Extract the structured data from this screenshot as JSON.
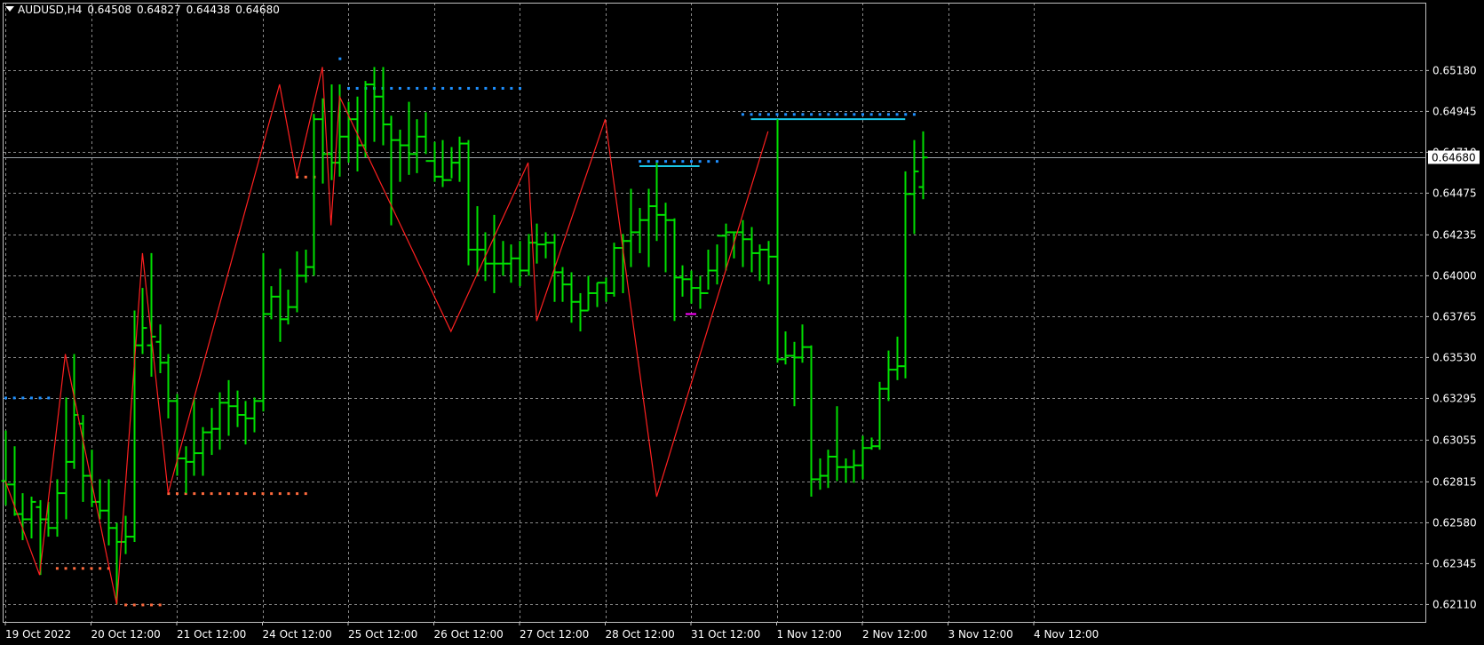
{
  "header": {
    "symbol": "AUDUSD,H4",
    "open": "0.64508",
    "high": "0.64827",
    "low": "0.64438",
    "close": "0.64680"
  },
  "price_tag": "0.64680",
  "colors": {
    "background": "#000000",
    "grid": "#8a8a8a",
    "axis": "#c0c0c0",
    "text": "#ffffff",
    "bars": "#00e000",
    "zigzag": "#ff2020",
    "resistance_dots": "#1e90ff",
    "support_dots": "#ff6a3d",
    "cyan_level": "#19c6e6",
    "magenta_mark": "#ff00ff"
  },
  "chart_data": {
    "type": "ohlc",
    "symbol": "AUDUSD",
    "timeframe": "H4",
    "grid": true,
    "ylim": [
      0.6201,
      0.6557
    ],
    "y_ticks": [
      "0.65180",
      "0.64945",
      "0.64710",
      "0.64475",
      "0.64235",
      "0.64000",
      "0.63765",
      "0.63530",
      "0.63295",
      "0.63055",
      "0.62815",
      "0.62580",
      "0.62345",
      "0.62110"
    ],
    "x_labels": [
      "19 Oct 2022",
      "20 Oct 12:00",
      "21 Oct 12:00",
      "24 Oct 12:00",
      "25 Oct 12:00",
      "26 Oct 12:00",
      "27 Oct 12:00",
      "28 Oct 12:00",
      "31 Oct 12:00",
      "1 Nov 12:00",
      "2 Nov 12:00",
      "3 Nov 12:00",
      "4 Nov 12:00"
    ],
    "current_price": 0.6468,
    "bars": [
      {
        "i": 0,
        "o": 0.6282,
        "h": 0.6311,
        "l": 0.6268,
        "c": 0.628
      },
      {
        "i": 1,
        "o": 0.628,
        "h": 0.6302,
        "l": 0.6262,
        "c": 0.6263
      },
      {
        "i": 2,
        "o": 0.6263,
        "h": 0.6275,
        "l": 0.6248,
        "c": 0.626
      },
      {
        "i": 3,
        "o": 0.626,
        "h": 0.6273,
        "l": 0.6249,
        "c": 0.627
      },
      {
        "i": 4,
        "o": 0.6267,
        "h": 0.6271,
        "l": 0.6228,
        "c": 0.626
      },
      {
        "i": 5,
        "o": 0.626,
        "h": 0.627,
        "l": 0.625,
        "c": 0.6255
      },
      {
        "i": 6,
        "o": 0.6255,
        "h": 0.6283,
        "l": 0.625,
        "c": 0.6275
      },
      {
        "i": 7,
        "o": 0.6275,
        "h": 0.633,
        "l": 0.626,
        "c": 0.6293
      },
      {
        "i": 8,
        "o": 0.6293,
        "h": 0.6355,
        "l": 0.6289,
        "c": 0.632
      },
      {
        "i": 9,
        "o": 0.6315,
        "h": 0.632,
        "l": 0.627,
        "c": 0.6285
      },
      {
        "i": 10,
        "o": 0.6285,
        "h": 0.63,
        "l": 0.6267,
        "c": 0.627
      },
      {
        "i": 11,
        "o": 0.627,
        "h": 0.6283,
        "l": 0.626,
        "c": 0.6265
      },
      {
        "i": 12,
        "o": 0.6265,
        "h": 0.6283,
        "l": 0.6245,
        "c": 0.6255
      },
      {
        "i": 13,
        "o": 0.6255,
        "h": 0.6258,
        "l": 0.6211,
        "c": 0.6247
      },
      {
        "i": 14,
        "o": 0.6247,
        "h": 0.6262,
        "l": 0.624,
        "c": 0.625
      },
      {
        "i": 15,
        "o": 0.625,
        "h": 0.638,
        "l": 0.6247,
        "c": 0.636
      },
      {
        "i": 16,
        "o": 0.636,
        "h": 0.6393,
        "l": 0.6355,
        "c": 0.637
      },
      {
        "i": 17,
        "o": 0.636,
        "h": 0.6413,
        "l": 0.6342,
        "c": 0.6365
      },
      {
        "i": 18,
        "o": 0.6362,
        "h": 0.6372,
        "l": 0.6344,
        "c": 0.635
      },
      {
        "i": 19,
        "o": 0.635,
        "h": 0.6355,
        "l": 0.6318,
        "c": 0.6328
      },
      {
        "i": 20,
        "o": 0.6328,
        "h": 0.6332,
        "l": 0.6285,
        "c": 0.6295
      },
      {
        "i": 21,
        "o": 0.6295,
        "h": 0.6302,
        "l": 0.6275,
        "c": 0.6293
      },
      {
        "i": 22,
        "o": 0.6293,
        "h": 0.633,
        "l": 0.6285,
        "c": 0.6298
      },
      {
        "i": 23,
        "o": 0.6298,
        "h": 0.6313,
        "l": 0.6285,
        "c": 0.631
      },
      {
        "i": 24,
        "o": 0.631,
        "h": 0.6324,
        "l": 0.6297,
        "c": 0.6312
      },
      {
        "i": 25,
        "o": 0.6312,
        "h": 0.6333,
        "l": 0.63,
        "c": 0.6327
      },
      {
        "i": 26,
        "o": 0.6327,
        "h": 0.634,
        "l": 0.6308,
        "c": 0.6325
      },
      {
        "i": 27,
        "o": 0.6325,
        "h": 0.6334,
        "l": 0.6313,
        "c": 0.632
      },
      {
        "i": 28,
        "o": 0.632,
        "h": 0.6328,
        "l": 0.6303,
        "c": 0.6318
      },
      {
        "i": 29,
        "o": 0.6318,
        "h": 0.633,
        "l": 0.631,
        "c": 0.6328
      },
      {
        "i": 30,
        "o": 0.6328,
        "h": 0.6413,
        "l": 0.6322,
        "c": 0.6378
      },
      {
        "i": 31,
        "o": 0.6378,
        "h": 0.6394,
        "l": 0.6375,
        "c": 0.6388
      },
      {
        "i": 32,
        "o": 0.6388,
        "h": 0.6404,
        "l": 0.6362,
        "c": 0.6375
      },
      {
        "i": 33,
        "o": 0.6375,
        "h": 0.6392,
        "l": 0.6372,
        "c": 0.6382
      },
      {
        "i": 34,
        "o": 0.6382,
        "h": 0.6414,
        "l": 0.6379,
        "c": 0.64
      },
      {
        "i": 35,
        "o": 0.64,
        "h": 0.6415,
        "l": 0.6396,
        "c": 0.6405
      },
      {
        "i": 36,
        "o": 0.6405,
        "h": 0.6493,
        "l": 0.64,
        "c": 0.649
      },
      {
        "i": 37,
        "o": 0.649,
        "h": 0.6502,
        "l": 0.6453,
        "c": 0.647
      },
      {
        "i": 38,
        "o": 0.647,
        "h": 0.651,
        "l": 0.6455,
        "c": 0.6465
      },
      {
        "i": 39,
        "o": 0.6465,
        "h": 0.651,
        "l": 0.6457,
        "c": 0.648
      },
      {
        "i": 40,
        "o": 0.648,
        "h": 0.65,
        "l": 0.6465,
        "c": 0.649
      },
      {
        "i": 41,
        "o": 0.649,
        "h": 0.6503,
        "l": 0.646,
        "c": 0.6475
      },
      {
        "i": 42,
        "o": 0.6475,
        "h": 0.6512,
        "l": 0.6468,
        "c": 0.651
      },
      {
        "i": 43,
        "o": 0.651,
        "h": 0.652,
        "l": 0.6477,
        "c": 0.6503
      },
      {
        "i": 44,
        "o": 0.6503,
        "h": 0.652,
        "l": 0.6475,
        "c": 0.6487
      },
      {
        "i": 45,
        "o": 0.6487,
        "h": 0.6492,
        "l": 0.6429,
        "c": 0.6478
      },
      {
        "i": 46,
        "o": 0.6478,
        "h": 0.6484,
        "l": 0.6454,
        "c": 0.6475
      },
      {
        "i": 47,
        "o": 0.6475,
        "h": 0.65,
        "l": 0.6458,
        "c": 0.647
      },
      {
        "i": 48,
        "o": 0.647,
        "h": 0.649,
        "l": 0.6459,
        "c": 0.648
      },
      {
        "i": 49,
        "o": 0.648,
        "h": 0.6494,
        "l": 0.647,
        "c": 0.6466
      },
      {
        "i": 50,
        "o": 0.6466,
        "h": 0.6477,
        "l": 0.6454,
        "c": 0.6457
      },
      {
        "i": 51,
        "o": 0.6457,
        "h": 0.6478,
        "l": 0.6451,
        "c": 0.6455
      },
      {
        "i": 52,
        "o": 0.6455,
        "h": 0.6474,
        "l": 0.6456,
        "c": 0.6465
      },
      {
        "i": 53,
        "o": 0.6465,
        "h": 0.648,
        "l": 0.6454,
        "c": 0.6476
      },
      {
        "i": 54,
        "o": 0.6476,
        "h": 0.6478,
        "l": 0.6406,
        "c": 0.6415
      },
      {
        "i": 55,
        "o": 0.6415,
        "h": 0.644,
        "l": 0.64,
        "c": 0.6415
      },
      {
        "i": 56,
        "o": 0.6415,
        "h": 0.6425,
        "l": 0.6397,
        "c": 0.6407
      },
      {
        "i": 57,
        "o": 0.6407,
        "h": 0.6435,
        "l": 0.639,
        "c": 0.6407
      },
      {
        "i": 58,
        "o": 0.6407,
        "h": 0.642,
        "l": 0.64,
        "c": 0.6407
      },
      {
        "i": 59,
        "o": 0.6407,
        "h": 0.6418,
        "l": 0.6396,
        "c": 0.641
      },
      {
        "i": 60,
        "o": 0.641,
        "h": 0.642,
        "l": 0.6394,
        "c": 0.6403
      },
      {
        "i": 61,
        "o": 0.6403,
        "h": 0.6424,
        "l": 0.64,
        "c": 0.6419
      },
      {
        "i": 62,
        "o": 0.6419,
        "h": 0.643,
        "l": 0.6407,
        "c": 0.6418
      },
      {
        "i": 63,
        "o": 0.6418,
        "h": 0.6425,
        "l": 0.641,
        "c": 0.6419
      },
      {
        "i": 64,
        "o": 0.6419,
        "h": 0.6424,
        "l": 0.6385,
        "c": 0.6402
      },
      {
        "i": 65,
        "o": 0.6402,
        "h": 0.6405,
        "l": 0.6385,
        "c": 0.6395
      },
      {
        "i": 66,
        "o": 0.6395,
        "h": 0.6402,
        "l": 0.6373,
        "c": 0.6385
      },
      {
        "i": 67,
        "o": 0.6385,
        "h": 0.639,
        "l": 0.6368,
        "c": 0.638
      },
      {
        "i": 68,
        "o": 0.638,
        "h": 0.64,
        "l": 0.638,
        "c": 0.639
      },
      {
        "i": 69,
        "o": 0.639,
        "h": 0.6396,
        "l": 0.6382,
        "c": 0.6396
      },
      {
        "i": 70,
        "o": 0.6396,
        "h": 0.6399,
        "l": 0.6385,
        "c": 0.639
      },
      {
        "i": 71,
        "o": 0.639,
        "h": 0.6419,
        "l": 0.6388,
        "c": 0.6416
      },
      {
        "i": 72,
        "o": 0.6416,
        "h": 0.6424,
        "l": 0.639,
        "c": 0.642
      },
      {
        "i": 73,
        "o": 0.642,
        "h": 0.645,
        "l": 0.6405,
        "c": 0.6425
      },
      {
        "i": 74,
        "o": 0.6425,
        "h": 0.6439,
        "l": 0.6413,
        "c": 0.6432
      },
      {
        "i": 75,
        "o": 0.6432,
        "h": 0.645,
        "l": 0.6405,
        "c": 0.644
      },
      {
        "i": 76,
        "o": 0.644,
        "h": 0.6465,
        "l": 0.642,
        "c": 0.6435
      },
      {
        "i": 77,
        "o": 0.6435,
        "h": 0.6442,
        "l": 0.6402,
        "c": 0.6432
      },
      {
        "i": 78,
        "o": 0.6432,
        "h": 0.6433,
        "l": 0.6374,
        "c": 0.6399
      },
      {
        "i": 79,
        "o": 0.6399,
        "h": 0.6406,
        "l": 0.6388,
        "c": 0.6398
      },
      {
        "i": 80,
        "o": 0.6398,
        "h": 0.6403,
        "l": 0.6384,
        "c": 0.6393
      },
      {
        "i": 81,
        "o": 0.6393,
        "h": 0.64,
        "l": 0.6381,
        "c": 0.639
      },
      {
        "i": 82,
        "o": 0.639,
        "h": 0.6415,
        "l": 0.6392,
        "c": 0.6403
      },
      {
        "i": 83,
        "o": 0.6403,
        "h": 0.6418,
        "l": 0.6395,
        "c": 0.6423
      },
      {
        "i": 84,
        "o": 0.6423,
        "h": 0.643,
        "l": 0.6403,
        "c": 0.6425
      },
      {
        "i": 85,
        "o": 0.6425,
        "h": 0.6425,
        "l": 0.641,
        "c": 0.6425
      },
      {
        "i": 86,
        "o": 0.6425,
        "h": 0.6432,
        "l": 0.6405,
        "c": 0.6421
      },
      {
        "i": 87,
        "o": 0.6421,
        "h": 0.6428,
        "l": 0.6402,
        "c": 0.6413
      },
      {
        "i": 88,
        "o": 0.6413,
        "h": 0.6418,
        "l": 0.6397,
        "c": 0.6415
      },
      {
        "i": 89,
        "o": 0.6415,
        "h": 0.642,
        "l": 0.6395,
        "c": 0.6411
      },
      {
        "i": 90,
        "o": 0.6411,
        "h": 0.649,
        "l": 0.635,
        "c": 0.6352
      },
      {
        "i": 91,
        "o": 0.6352,
        "h": 0.6368,
        "l": 0.6349,
        "c": 0.6354
      },
      {
        "i": 92,
        "o": 0.6354,
        "h": 0.6362,
        "l": 0.6325,
        "c": 0.6353
      },
      {
        "i": 93,
        "o": 0.6353,
        "h": 0.6372,
        "l": 0.635,
        "c": 0.6359
      },
      {
        "i": 94,
        "o": 0.6359,
        "h": 0.636,
        "l": 0.6273,
        "c": 0.6283
      },
      {
        "i": 95,
        "o": 0.6283,
        "h": 0.6295,
        "l": 0.6277,
        "c": 0.6285
      },
      {
        "i": 96,
        "o": 0.6285,
        "h": 0.63,
        "l": 0.6278,
        "c": 0.6296
      },
      {
        "i": 97,
        "o": 0.6296,
        "h": 0.6325,
        "l": 0.6282,
        "c": 0.629
      },
      {
        "i": 98,
        "o": 0.629,
        "h": 0.6295,
        "l": 0.6281,
        "c": 0.629
      },
      {
        "i": 99,
        "o": 0.629,
        "h": 0.63,
        "l": 0.6281,
        "c": 0.6291
      },
      {
        "i": 100,
        "o": 0.6291,
        "h": 0.6308,
        "l": 0.6283,
        "c": 0.6301
      },
      {
        "i": 101,
        "o": 0.6301,
        "h": 0.6307,
        "l": 0.63,
        "c": 0.6302
      },
      {
        "i": 102,
        "o": 0.6302,
        "h": 0.6339,
        "l": 0.63,
        "c": 0.6335
      },
      {
        "i": 103,
        "o": 0.6335,
        "h": 0.6357,
        "l": 0.6328,
        "c": 0.6346
      },
      {
        "i": 104,
        "o": 0.6346,
        "h": 0.6365,
        "l": 0.634,
        "c": 0.6348
      },
      {
        "i": 105,
        "o": 0.6348,
        "h": 0.646,
        "l": 0.6341,
        "c": 0.6447
      },
      {
        "i": 106,
        "o": 0.6447,
        "h": 0.6478,
        "l": 0.6424,
        "c": 0.646
      },
      {
        "i": 107,
        "o": 0.6451,
        "h": 0.6483,
        "l": 0.6444,
        "c": 0.6468
      }
    ],
    "zigzag": [
      {
        "i": 0,
        "p": 0.6282
      },
      {
        "i": 4,
        "p": 0.6228
      },
      {
        "i": 7,
        "p": 0.6355
      },
      {
        "i": 13,
        "p": 0.6211
      },
      {
        "i": 16,
        "p": 0.6413
      },
      {
        "i": 19,
        "p": 0.6275
      },
      {
        "i": 32,
        "p": 0.651
      },
      {
        "i": 34,
        "p": 0.6457
      },
      {
        "i": 37,
        "p": 0.652
      },
      {
        "i": 38,
        "p": 0.6429
      },
      {
        "i": 39,
        "p": 0.6503
      },
      {
        "i": 52,
        "p": 0.6368
      },
      {
        "i": 61,
        "p": 0.6465
      },
      {
        "i": 62,
        "p": 0.6374
      },
      {
        "i": 70,
        "p": 0.649
      },
      {
        "i": 76,
        "p": 0.6273
      },
      {
        "i": 89,
        "p": 0.6483
      }
    ],
    "resistance_levels": [
      {
        "from": 0,
        "to": 5,
        "p": 0.633
      },
      {
        "from": 39,
        "to": 39,
        "p": 0.6525
      },
      {
        "from": 40,
        "to": 60,
        "p": 0.6508
      },
      {
        "from": 74,
        "to": 83,
        "p": 0.6466
      },
      {
        "from": 86,
        "to": 106,
        "p": 0.6493
      }
    ],
    "support_levels": [
      {
        "from": 6,
        "to": 12,
        "p": 0.6232
      },
      {
        "from": 14,
        "to": 18,
        "p": 0.6211
      },
      {
        "from": 19,
        "to": 35,
        "p": 0.6275
      },
      {
        "from": 34,
        "to": 36,
        "p": 0.6457
      }
    ],
    "cyan_levels": [
      {
        "from": 74,
        "to": 81,
        "p": 0.6463
      },
      {
        "from": 87,
        "to": 105,
        "p": 0.649
      }
    ],
    "magenta_marks": [
      {
        "i": 80,
        "p": 0.6378
      }
    ]
  }
}
